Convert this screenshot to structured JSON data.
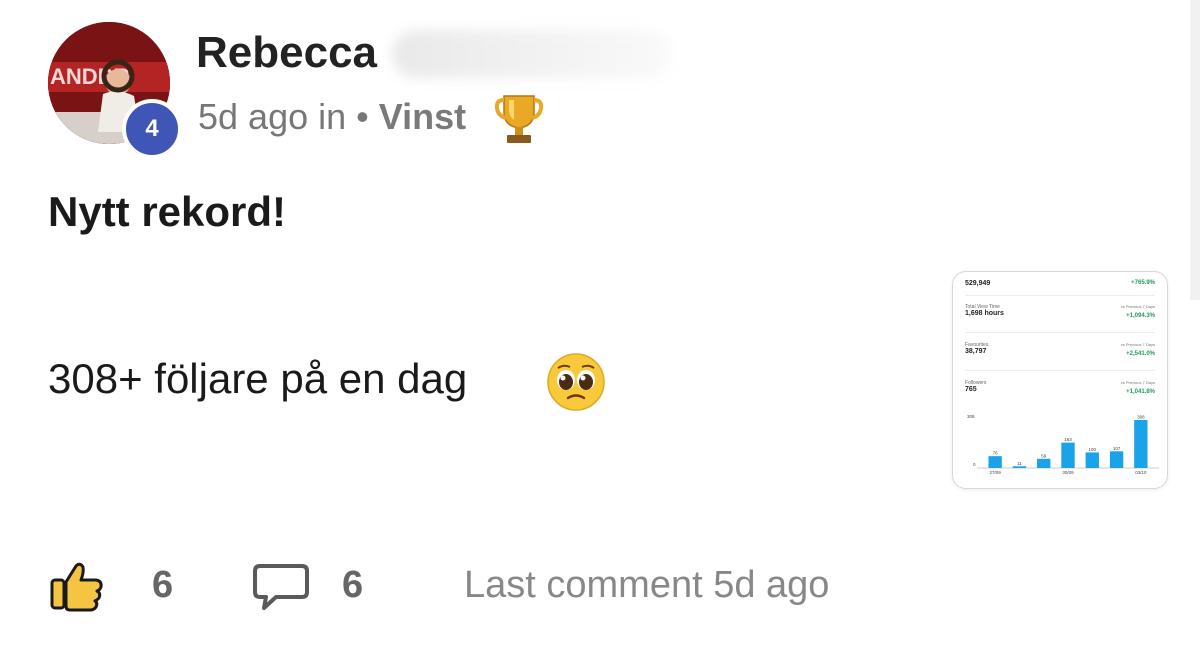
{
  "post": {
    "author": "Rebecca",
    "level": "4",
    "time": "5d ago",
    "in_label": "in",
    "category": "Vinst",
    "title": "Nytt rekord!",
    "body": "308+ följare på en dag",
    "likes": "6",
    "comments": "6",
    "last_comment": "Last comment 5d ago"
  },
  "icons": {
    "trophy": "trophy-icon",
    "emoji": "pleading-face-emoji",
    "like": "thumbs-up-icon",
    "comment": "speech-bubble-icon"
  },
  "thumbnail": {
    "top_value": "529,949",
    "top_change": "+765.9%",
    "stats": [
      {
        "label": "Total View Time",
        "value": "1,698 hours",
        "compare": "vs Previous 7 Days",
        "change": "+1,094.3%"
      },
      {
        "label": "Favourites",
        "value": "38,797",
        "compare": "vs Previous 7 Days",
        "change": "+2,541.0%"
      },
      {
        "label": "Followers",
        "value": "765",
        "compare": "vs Previous 7 Days",
        "change": "+1,041.8%"
      }
    ],
    "chart_data": {
      "type": "bar",
      "categories": [
        "27/09",
        "28/09",
        "29/09",
        "30/09",
        "01/10",
        "02/10",
        "03/10"
      ],
      "values": [
        76,
        11,
        59,
        163,
        100,
        107,
        308
      ],
      "ymax_label": "308",
      "zero_label": "0",
      "tick_labels": [
        "27/09",
        "30/09",
        "03/10"
      ],
      "color": "#1aa3e8"
    }
  },
  "colors": {
    "badge": "#3f56b6",
    "positive_change": "#1e9c5a",
    "bar": "#1aa3e8"
  }
}
